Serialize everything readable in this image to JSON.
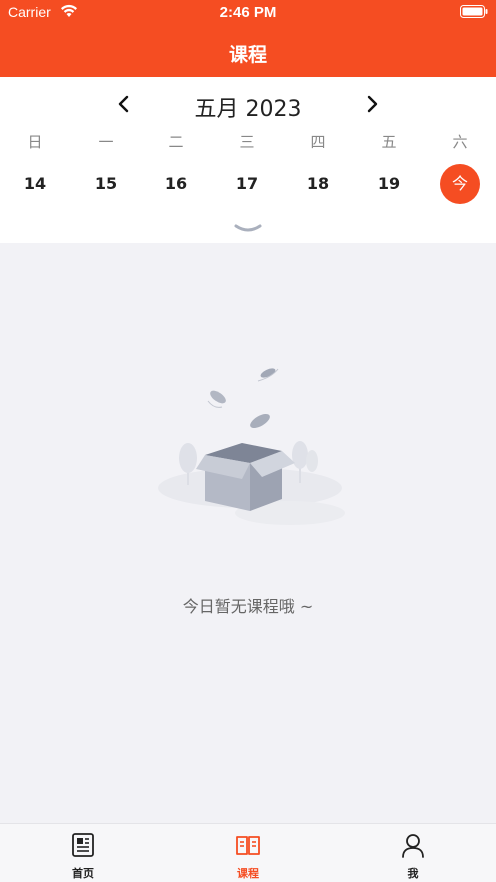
{
  "status_bar": {
    "carrier": "Carrier",
    "time": "2:46 PM"
  },
  "nav": {
    "title": "课程"
  },
  "calendar": {
    "month_label": "五月 2023",
    "weekdays": [
      "日",
      "一",
      "二",
      "三",
      "四",
      "五",
      "六"
    ],
    "dates": [
      "14",
      "15",
      "16",
      "17",
      "18",
      "19",
      "今"
    ]
  },
  "empty_state": {
    "message": "今日暂无课程哦 ~"
  },
  "tabs": [
    {
      "label": "首页",
      "icon": "newspaper-icon"
    },
    {
      "label": "课程",
      "icon": "book-icon"
    },
    {
      "label": "我",
      "icon": "user-icon"
    }
  ],
  "colors": {
    "accent": "#f54d22",
    "background": "#f2f2f6"
  }
}
